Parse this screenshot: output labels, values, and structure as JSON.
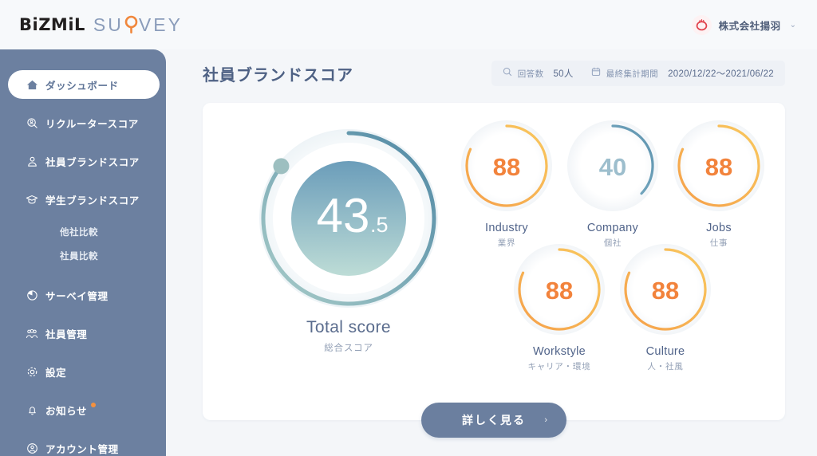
{
  "brand": {
    "name_bold": "BiZMiL",
    "name_light": "SURVEY"
  },
  "account": {
    "name": "株式会社揚羽",
    "caret": "⌄"
  },
  "sidebar": {
    "items": [
      {
        "label": "ダッシュボード",
        "icon": "home-icon",
        "active": true
      },
      {
        "label": "リクルータースコア",
        "icon": "search-person-icon",
        "active": false
      },
      {
        "label": "社員ブランドスコア",
        "icon": "person-icon",
        "active": false
      },
      {
        "label": "学生ブランドスコア",
        "icon": "graduation-cap-icon",
        "active": false
      }
    ],
    "sub_items": [
      {
        "label": "他社比較"
      },
      {
        "label": "社員比較"
      }
    ],
    "items2": [
      {
        "label": "サーベイ管理",
        "icon": "survey-icon",
        "badge": false
      },
      {
        "label": "社員管理",
        "icon": "people-icon",
        "badge": false
      },
      {
        "label": "設定",
        "icon": "gear-icon",
        "badge": false
      },
      {
        "label": "お知らせ",
        "icon": "bell-icon",
        "badge": true
      },
      {
        "label": "アカウント管理",
        "icon": "account-circle-icon",
        "badge": false
      }
    ]
  },
  "header": {
    "title": "社員ブランドスコア",
    "filters": [
      {
        "icon": "search-icon",
        "label": "回答数",
        "value": "50人"
      },
      {
        "icon": "calendar-icon",
        "label": "最終集計期間",
        "value": "2020/12/22〜2021/06/22"
      }
    ]
  },
  "main": {
    "total": {
      "value_int": "43",
      "value_dec": ".5",
      "label_en": "Total score",
      "label_jp": "総合スコア",
      "percent": 43.5,
      "arc_color_start": "#4e87a4",
      "arc_color_end": "#a9cdc9",
      "fill_top": "#6b9dba",
      "fill_bottom": "#bddcd6"
    },
    "metrics": [
      {
        "value": "88",
        "label_en": "Industry",
        "label_jp": "業界",
        "percent": 88,
        "color_start": "#f5a04a",
        "color_end": "#f9c85e",
        "text_color": "#f2833c"
      },
      {
        "value": "40",
        "label_en": "Company",
        "label_jp": "個社",
        "percent": 40,
        "color_start": "#7badc4",
        "color_end": "#5e93ae",
        "text_color": "#9dbecd"
      },
      {
        "value": "88",
        "label_en": "Jobs",
        "label_jp": "仕事",
        "percent": 88,
        "color_start": "#f5a04a",
        "color_end": "#f9c85e",
        "text_color": "#f2833c"
      },
      {
        "value": "88",
        "label_en": "Workstyle",
        "label_jp": "キャリア・環境",
        "percent": 88,
        "color_start": "#f5a04a",
        "color_end": "#f9c85e",
        "text_color": "#f2833c"
      },
      {
        "value": "88",
        "label_en": "Culture",
        "label_jp": "人・社風",
        "percent": 88,
        "color_start": "#f5a04a",
        "color_end": "#f9c85e",
        "text_color": "#f2833c"
      }
    ],
    "more_button": {
      "label": "詳しく見る",
      "chevron": "›"
    }
  },
  "chart_data": {
    "type": "pie",
    "title": "社員ブランドスコア",
    "categories": [
      "Total score",
      "Industry",
      "Company",
      "Jobs",
      "Workstyle",
      "Culture"
    ],
    "values": [
      43.5,
      88,
      40,
      88,
      88,
      88
    ],
    "ylim": [
      0,
      100
    ]
  }
}
